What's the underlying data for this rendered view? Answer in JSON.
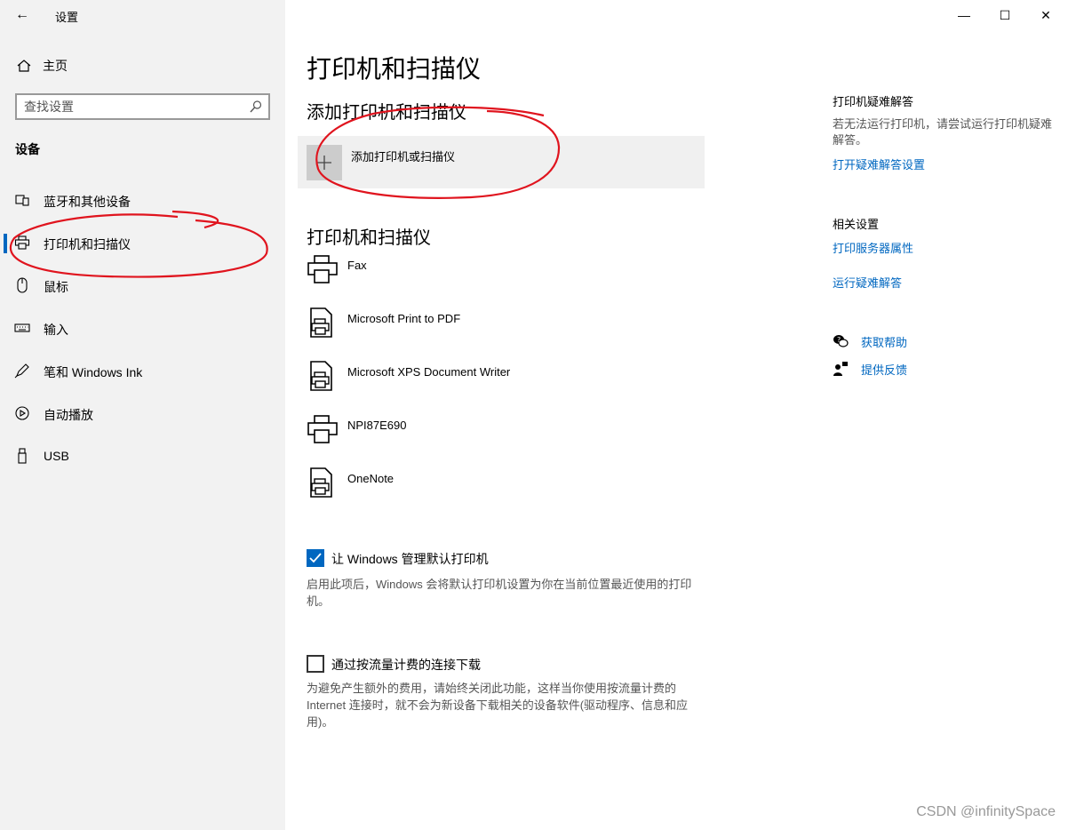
{
  "window": {
    "title": "设置",
    "back_glyph": "←",
    "controls": {
      "minimize": "—",
      "maximize": "☐",
      "close": "✕"
    }
  },
  "sidebar": {
    "home_label": "主页",
    "search_placeholder": "查找设置",
    "section_label": "设备",
    "items": [
      {
        "label": "蓝牙和其他设备",
        "icon": "bluetooth-devices-icon"
      },
      {
        "label": "打印机和扫描仪",
        "icon": "printer-icon",
        "selected": true
      },
      {
        "label": "鼠标",
        "icon": "mouse-icon"
      },
      {
        "label": "输入",
        "icon": "keyboard-icon"
      },
      {
        "label": "笔和 Windows Ink",
        "icon": "pen-icon"
      },
      {
        "label": "自动播放",
        "icon": "autoplay-icon"
      },
      {
        "label": "USB",
        "icon": "usb-icon"
      }
    ]
  },
  "main": {
    "title": "打印机和扫描仪",
    "add_section_title": "添加打印机和扫描仪",
    "add_button_label": "添加打印机或扫描仪",
    "devices_section_title": "打印机和扫描仪",
    "devices": [
      {
        "label": "Fax",
        "icon": "printer-icon"
      },
      {
        "label": "Microsoft Print to PDF",
        "icon": "document-printer-icon"
      },
      {
        "label": "Microsoft XPS Document Writer",
        "icon": "document-printer-icon"
      },
      {
        "label": "NPI87E690",
        "icon": "printer-icon"
      },
      {
        "label": "OneNote",
        "icon": "document-printer-icon"
      }
    ],
    "default_printer": {
      "label": "让 Windows 管理默认打印机",
      "checked": true,
      "desc": "启用此项后，Windows 会将默认打印机设置为你在当前位置最近使用的打印机。"
    },
    "metered_download": {
      "label": "通过按流量计费的连接下载",
      "checked": false,
      "desc": "为避免产生额外的费用，请始终关闭此功能，这样当你使用按流量计费的 Internet 连接时，就不会为新设备下载相关的设备软件(驱动程序、信息和应用)。"
    }
  },
  "right_panel": {
    "troubleshoot_title": "打印机疑难解答",
    "troubleshoot_text": "若无法运行打印机，请尝试运行打印机疑难解答。",
    "troubleshoot_link": "打开疑难解答设置",
    "related_title": "相关设置",
    "related_links": [
      "打印服务器属性",
      "运行疑难解答"
    ],
    "help_label": "获取帮助",
    "feedback_label": "提供反馈"
  },
  "watermark": "CSDN @infinitySpace",
  "colors": {
    "accent": "#0067c0",
    "annotation": "#e0141e",
    "sidebar_bg": "#f2f2f2"
  }
}
